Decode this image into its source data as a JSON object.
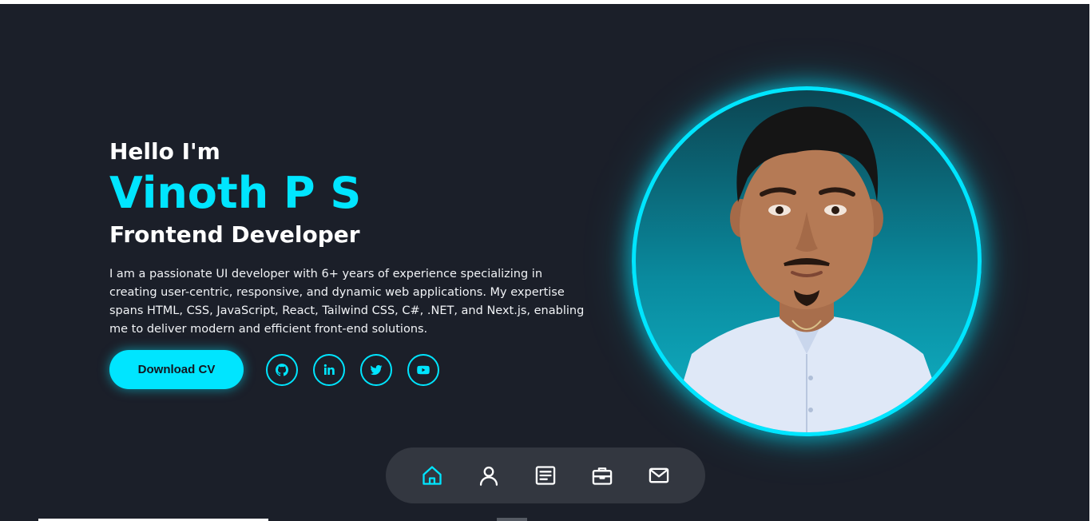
{
  "hero": {
    "greeting": "Hello I'm",
    "name": "Vinoth P S",
    "role": "Frontend Developer",
    "bio": "I am a passionate UI developer with 6+ years of experience specializing in creating user-centric, responsive, and dynamic web applications. My expertise spans HTML, CSS, JavaScript, React, Tailwind CSS, C#, .NET, and Next.js, enabling me to deliver modern and efficient front-end solutions.",
    "cv_button_label": "Download CV"
  },
  "social": [
    {
      "icon": "github-icon"
    },
    {
      "icon": "linkedin-icon"
    },
    {
      "icon": "twitter-icon"
    },
    {
      "icon": "youtube-icon"
    }
  ],
  "nav": [
    {
      "icon": "home-icon",
      "active": true
    },
    {
      "icon": "user-icon",
      "active": false
    },
    {
      "icon": "resume-icon",
      "active": false
    },
    {
      "icon": "briefcase-icon",
      "active": false
    },
    {
      "icon": "mail-icon",
      "active": false
    }
  ],
  "colors": {
    "accent": "#00e5ff",
    "background": "#1b1f29",
    "nav_background": "#333740"
  }
}
